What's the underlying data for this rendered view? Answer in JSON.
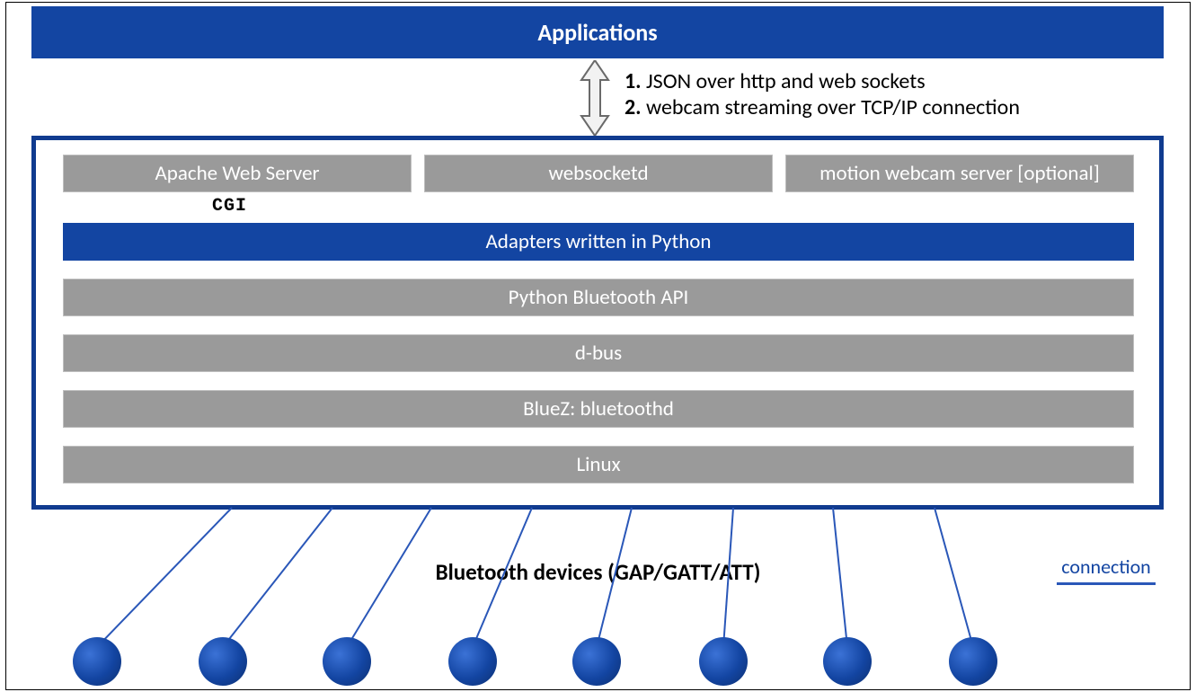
{
  "top": {
    "applications": "Applications"
  },
  "connection": {
    "line1_prefix": "1.",
    "line1": "JSON over http and web sockets",
    "line2_prefix": "2.",
    "line2": "webcam streaming over TCP/IP connection"
  },
  "servers": {
    "apache": "Apache Web Server",
    "websocketd": "websocketd",
    "motion": "motion webcam server [optional]"
  },
  "cgi_label": "CGI",
  "layers": {
    "adapters": "Adapters written in Python",
    "pyapi": "Python Bluetooth API",
    "dbus": "d-bus",
    "bluez": "BlueZ: bluetoothd",
    "linux": "Linux"
  },
  "devices_label": "Bluetooth devices (GAP/GATT/ATT)",
  "legend": "connection",
  "device_count": 8
}
